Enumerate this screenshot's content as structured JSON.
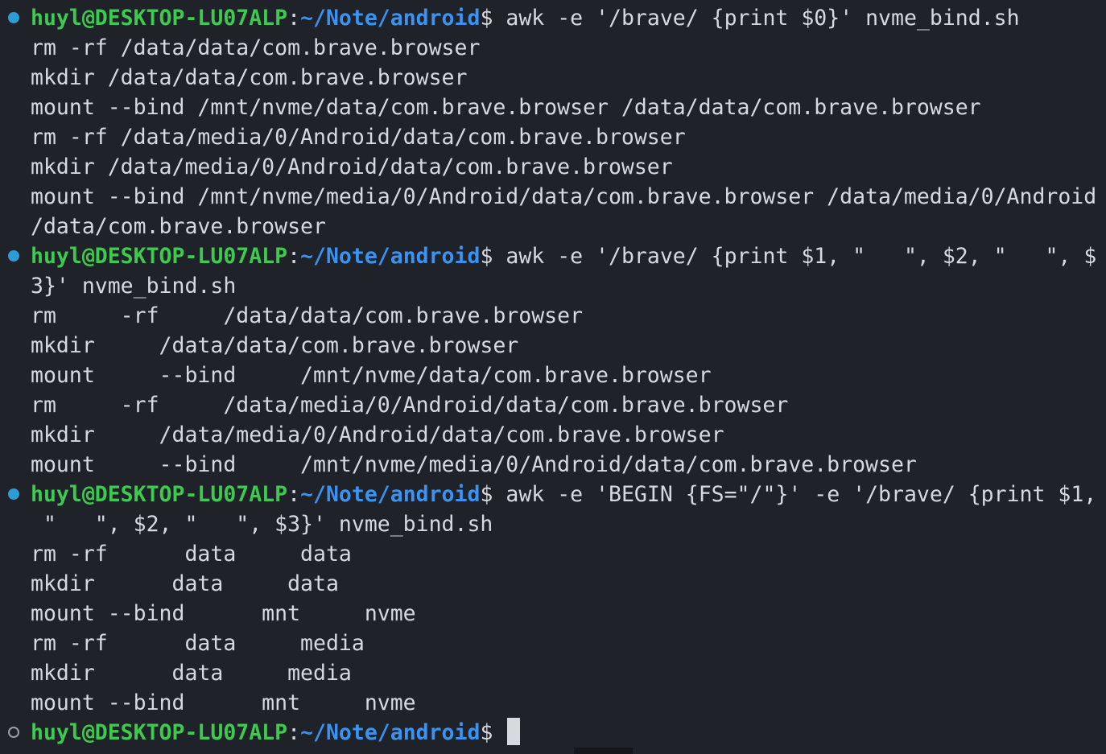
{
  "prompt": {
    "user": "huyl@DESKTOP-LU07ALP",
    "colon": ":",
    "path": "~/Note/android",
    "dollar": "$"
  },
  "blocks": [
    {
      "command_lines": [
        "awk -e '/brave/ {print $0}' nvme_bind.sh"
      ],
      "output": [
        "rm -rf /data/data/com.brave.browser",
        "mkdir /data/data/com.brave.browser",
        "mount --bind /mnt/nvme/data/com.brave.browser /data/data/com.brave.browser",
        "rm -rf /data/media/0/Android/data/com.brave.browser",
        "mkdir /data/media/0/Android/data/com.brave.browser",
        "mount --bind /mnt/nvme/media/0/Android/data/com.brave.browser /data/media/0/Android",
        "/data/com.brave.browser"
      ]
    },
    {
      "command_lines": [
        "awk -e '/brave/ {print $1, \"   \", $2, \"   \", $",
        "3}' nvme_bind.sh"
      ],
      "output": [
        "rm     -rf     /data/data/com.brave.browser",
        "mkdir     /data/data/com.brave.browser",
        "mount     --bind     /mnt/nvme/data/com.brave.browser",
        "rm     -rf     /data/media/0/Android/data/com.brave.browser",
        "mkdir     /data/media/0/Android/data/com.brave.browser",
        "mount     --bind     /mnt/nvme/media/0/Android/data/com.brave.browser"
      ]
    },
    {
      "command_lines": [
        "awk -e 'BEGIN {FS=\"/\"}' -e '/brave/ {print $1,",
        " \"   \", $2, \"   \", $3}' nvme_bind.sh"
      ],
      "output": [
        "rm -rf      data     data",
        "mkdir      data     data",
        "mount --bind      mnt     nvme",
        "rm -rf      data     media",
        "mkdir      data     media",
        "mount --bind      mnt     nvme"
      ]
    }
  ],
  "colors": {
    "background": "#1f2229",
    "user": "#3ec94f",
    "path": "#3a93f0",
    "text": "#d6d9de",
    "decoration_success": "#2f9cd6"
  }
}
